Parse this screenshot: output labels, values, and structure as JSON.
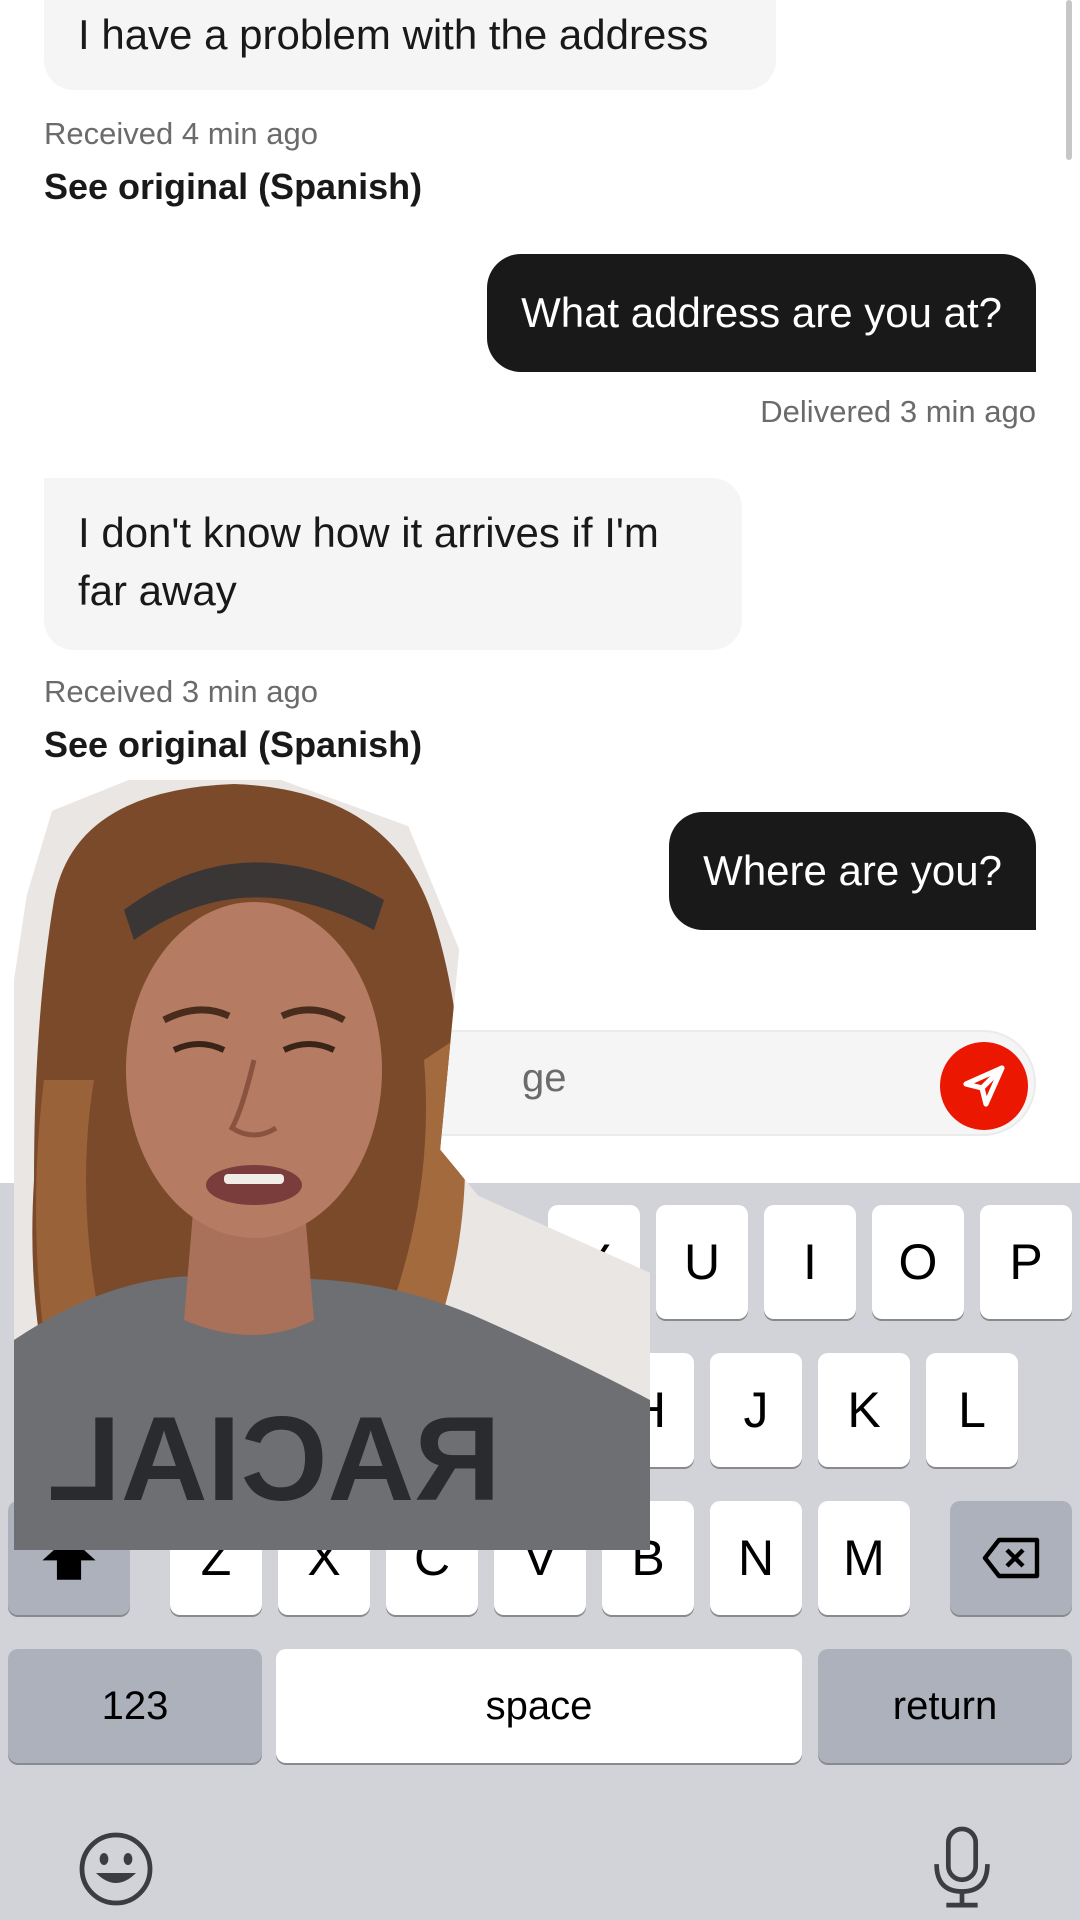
{
  "messages": [
    {
      "direction": "received",
      "text_lines": [
        "I have a problem with the address"
      ],
      "meta": "Received 4 min ago",
      "link": "See original (Spanish)"
    },
    {
      "direction": "sent",
      "text_lines": [
        "What address are you at?"
      ],
      "meta": "Delivered 3 min ago"
    },
    {
      "direction": "received",
      "text_lines": [
        "I don't know how it arrives if I'm",
        "far away"
      ],
      "meta": "Received 3 min ago",
      "link": "See original (Spanish)"
    },
    {
      "direction": "sent",
      "text_lines": [
        "Where are you?"
      ]
    }
  ],
  "compose": {
    "visible_placeholder_fragment": "ge"
  },
  "keyboard": {
    "row1_visible": [
      "Y",
      "U",
      "I",
      "O",
      "P"
    ],
    "row2_visible": [
      "H",
      "J",
      "K",
      "L"
    ],
    "row3_visible": [
      "Z",
      "X",
      "C",
      "V",
      "B",
      "N",
      "M"
    ],
    "numbers_label": "123",
    "space_label": "space",
    "return_label": "return"
  },
  "overlay": {
    "shirt_text": "RACIAL"
  },
  "colors": {
    "send_button": "#eb1700",
    "sent_bubble": "#191919",
    "received_bubble": "#f5f5f5",
    "keyboard_bg": "#d1d3d9"
  }
}
